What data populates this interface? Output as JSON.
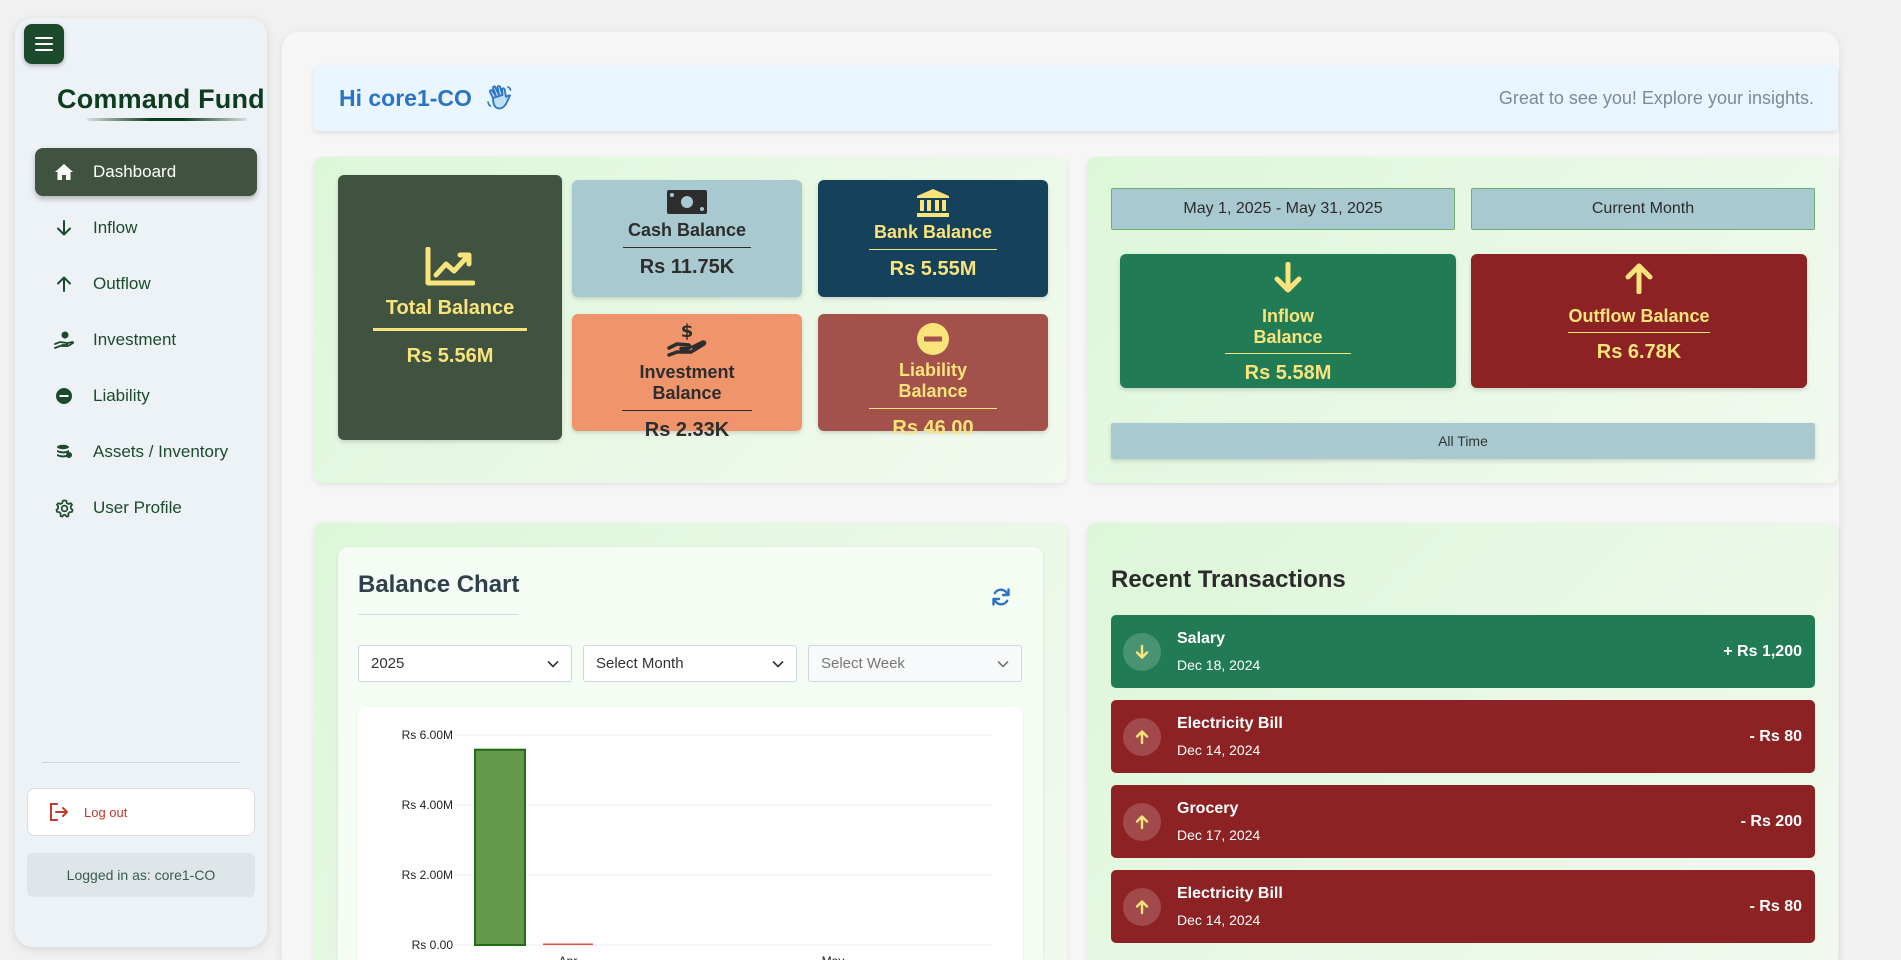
{
  "sidebar": {
    "brand": "Command Fund",
    "items": [
      {
        "label": "Dashboard",
        "icon": "home-icon"
      },
      {
        "label": "Inflow",
        "icon": "arrow-down-icon"
      },
      {
        "label": "Outflow",
        "icon": "arrow-up-icon"
      },
      {
        "label": "Investment",
        "icon": "hand-coin-icon"
      },
      {
        "label": "Liability",
        "icon": "minus-circle-icon"
      },
      {
        "label": "Assets / Inventory",
        "icon": "coins-stack-icon"
      },
      {
        "label": "User Profile",
        "icon": "gear-icon"
      }
    ],
    "logout_label": "Log out",
    "logged_in": "Logged in as: core1-CO"
  },
  "greeting": {
    "hello": "Hi core1-CO",
    "subtitle": "Great to see you! Explore your insights."
  },
  "balances": {
    "total": {
      "title": "Total Balance",
      "value": "Rs 5.56M"
    },
    "cash": {
      "title": "Cash Balance",
      "value": "Rs 11.75K"
    },
    "bank": {
      "title": "Bank Balance",
      "value": "Rs 5.55M"
    },
    "investment": {
      "title": "Investment Balance",
      "value": "Rs 2.33K"
    },
    "liability": {
      "title": "Liability Balance",
      "value": "Rs 46.00"
    }
  },
  "flow": {
    "date_range": "May 1, 2025 - May 31, 2025",
    "period": "Current Month",
    "inflow": {
      "title": "Inflow Balance",
      "value": "Rs 5.58M"
    },
    "outflow": {
      "title": "Outflow Balance",
      "value": "Rs 6.78K"
    },
    "all_time": "All Time"
  },
  "chart": {
    "title": "Balance Chart",
    "selects": {
      "year": "2025",
      "month": "Select Month",
      "week": "Select Week"
    }
  },
  "chart_data": {
    "type": "bar",
    "categories": [
      "Apr",
      "May"
    ],
    "series": [
      {
        "values": [
          5580000,
          0
        ],
        "color": "#64984b"
      },
      {
        "values": [
          6780,
          0
        ],
        "color": "#e74c3c"
      }
    ],
    "yticks": [
      "Rs 0.00",
      "Rs 2.00M",
      "Rs 4.00M",
      "Rs 6.00M"
    ],
    "ylim": [
      0,
      6000000
    ],
    "grid": true
  },
  "transactions": {
    "title": "Recent Transactions",
    "items": [
      {
        "name": "Salary",
        "date": "Dec 18, 2024",
        "amount": "+ Rs 1,200",
        "type": "in"
      },
      {
        "name": "Electricity Bill",
        "date": "Dec 14, 2024",
        "amount": "- Rs 80",
        "type": "out"
      },
      {
        "name": "Grocery",
        "date": "Dec 17, 2024",
        "amount": "- Rs 200",
        "type": "out"
      },
      {
        "name": "Electricity Bill",
        "date": "Dec 14, 2024",
        "amount": "- Rs 80",
        "type": "out"
      }
    ]
  }
}
